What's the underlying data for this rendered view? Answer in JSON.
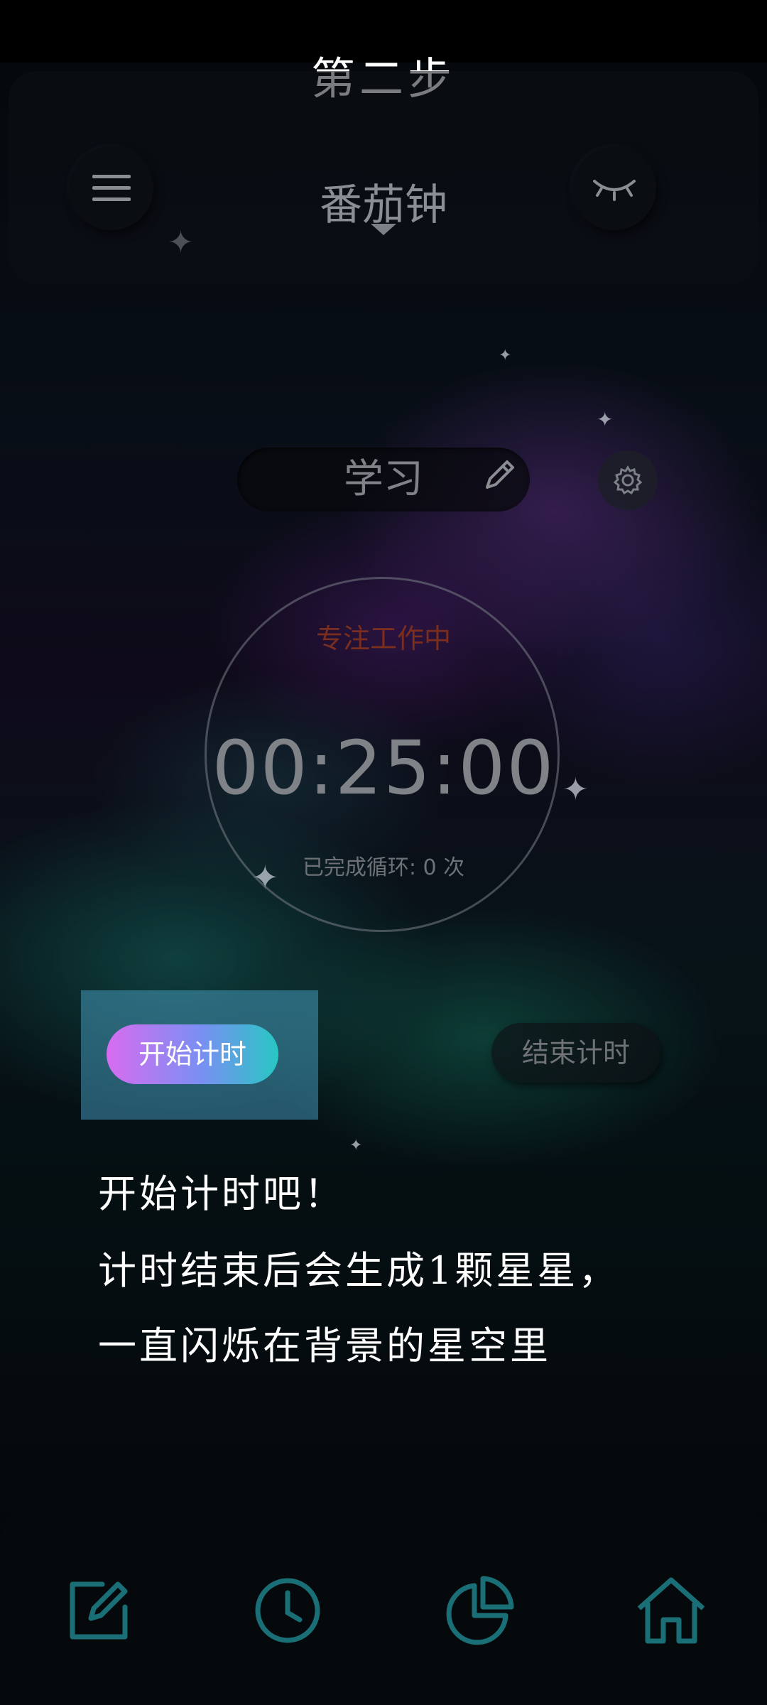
{
  "step": {
    "title": "第二步"
  },
  "header": {
    "title": "番茄钟",
    "menu_icon": "menu-icon",
    "eye_icon": "eye-closed-icon"
  },
  "task": {
    "label": "学习",
    "edit_icon": "pencil-icon",
    "settings_icon": "gear-icon"
  },
  "timer": {
    "status": "专注工作中",
    "value": "00:25:00",
    "cycles": "已完成循环: 0 次"
  },
  "actions": {
    "start_label": "开始计时",
    "end_label": "结束计时"
  },
  "guide": {
    "line1": "开始计时吧！",
    "line2": "计时结束后会生成1颗星星，",
    "line3": "一直闪烁在背景的星空里"
  },
  "bottom_nav": {
    "items": [
      "edit-icon",
      "clock-icon",
      "pie-chart-icon",
      "home-icon"
    ],
    "color": "#1a6e76"
  },
  "colors": {
    "start_gradient": [
      "#d86cf0",
      "#7a8ff2",
      "#27c7c4"
    ],
    "status_text": "#7a2e20",
    "highlight": "#50afd7"
  }
}
